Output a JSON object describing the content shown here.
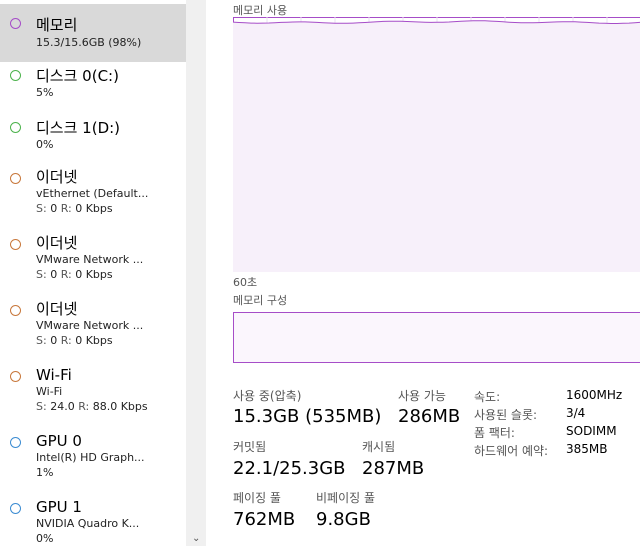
{
  "sidebar": {
    "items": [
      {
        "name": "메모리",
        "sub": "15.3/15.6GB (98%)",
        "dot": "#a64dc8",
        "selected": true
      },
      {
        "name": "디스크 0(C:)",
        "sub": "5%",
        "dot": "#4db34d"
      },
      {
        "name": "디스크 1(D:)",
        "sub": "0%",
        "dot": "#4db34d"
      },
      {
        "name": "이더넷",
        "sub": "vEthernet (Default...",
        "s": "0",
        "r": "0 Kbps",
        "dot": "#c8783c"
      },
      {
        "name": "이더넷",
        "sub": "VMware Network ...",
        "s": "0",
        "r": "0 Kbps",
        "dot": "#c8783c"
      },
      {
        "name": "이더넷",
        "sub": "VMware Network ...",
        "s": "0",
        "r": "0 Kbps",
        "dot": "#c8783c"
      },
      {
        "name": "Wi-Fi",
        "sub": "Wi-Fi",
        "s": "24.0",
        "r": "88.0 Kbps",
        "dot": "#c8783c"
      },
      {
        "name": "GPU 0",
        "sub": "Intel(R) HD Graph...",
        "sub2": "1%",
        "dot": "#3c8cd2"
      },
      {
        "name": "GPU 1",
        "sub": "NVIDIA Quadro K...",
        "sub2": "0%",
        "dot": "#3c8cd2"
      }
    ],
    "s_label": "S:",
    "r_label": "R:"
  },
  "memory": {
    "usage_label": "메모리 사용",
    "time_label": "60초",
    "composition_label": "메모리 구성",
    "usage_percent": 98,
    "graph_color": "#a64dc8"
  },
  "stats": {
    "in_use_label": "사용 중(압축)",
    "in_use_value": "15.3GB (535MB)",
    "available_label": "사용 가능",
    "available_value": "286MB",
    "committed_label": "커밋됨",
    "committed_value": "22.1/25.3GB",
    "cached_label": "캐시됨",
    "cached_value": "287MB",
    "paged_label": "페이징 풀",
    "paged_value": "762MB",
    "nonpaged_label": "비페이징 풀",
    "nonpaged_value": "9.8GB"
  },
  "props": {
    "speed_label": "속도:",
    "speed_value": "1600MHz",
    "slots_label": "사용된 슬롯:",
    "slots_value": "3/4",
    "form_label": "폼 팩터:",
    "form_value": "SODIMM",
    "reserved_label": "하드웨어 예약:",
    "reserved_value": "385MB"
  }
}
